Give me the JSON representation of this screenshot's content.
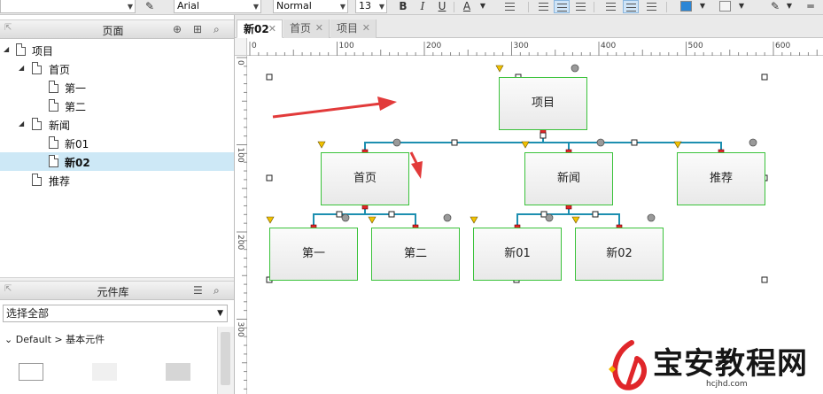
{
  "toolbar": {
    "font_family": "Arial",
    "font_style": "Normal",
    "font_size": "13",
    "bold": "B",
    "italic": "I",
    "underline": "U",
    "font_color_letter": "A",
    "colors": {
      "fill": "#2b86d6",
      "font": "#222222",
      "accent": "#cfe4f7"
    }
  },
  "pages_panel": {
    "title": "页面",
    "icons": [
      "add-page-icon",
      "add-folder-icon",
      "search-icon"
    ],
    "tree": [
      {
        "label": "项目",
        "level": 0,
        "expanded": true
      },
      {
        "label": "首页",
        "level": 1,
        "expanded": true
      },
      {
        "label": "第一",
        "level": 2
      },
      {
        "label": "第二",
        "level": 2
      },
      {
        "label": "新闻",
        "level": 1,
        "expanded": true
      },
      {
        "label": "新01",
        "level": 2
      },
      {
        "label": "新02",
        "level": 2,
        "selected": true
      },
      {
        "label": "推荐",
        "level": 1
      }
    ]
  },
  "library_panel": {
    "title": "元件库",
    "select_value": "选择全部",
    "category": "Default > 基本元件"
  },
  "tabs": [
    {
      "label": "新02",
      "active": true
    },
    {
      "label": "首页",
      "active": false
    },
    {
      "label": "项目",
      "active": false
    }
  ],
  "ruler": {
    "h_labels": [
      "0",
      "100",
      "200",
      "300",
      "400",
      "500",
      "600"
    ],
    "v_labels": [
      "0",
      "100",
      "200",
      "300"
    ]
  },
  "sitemap": {
    "nodes": [
      {
        "id": "n0",
        "label": "项目"
      },
      {
        "id": "n1",
        "label": "首页"
      },
      {
        "id": "n2",
        "label": "新闻"
      },
      {
        "id": "n3",
        "label": "推荐"
      },
      {
        "id": "n4",
        "label": "第一"
      },
      {
        "id": "n5",
        "label": "第二"
      },
      {
        "id": "n6",
        "label": "新01"
      },
      {
        "id": "n7",
        "label": "新02"
      }
    ],
    "colors": {
      "connector": "#1d8fb0",
      "node_border": "#3ac23a",
      "arrow": "#e23a3a"
    }
  },
  "watermark": {
    "text": "宝安教程网",
    "url": "hcjhd.com"
  }
}
